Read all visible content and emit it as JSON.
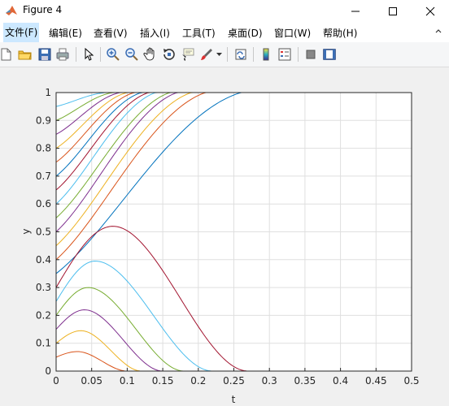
{
  "window": {
    "title": "Figure 4",
    "minimize_icon": "minimize-icon",
    "maximize_icon": "maximize-icon",
    "close_icon": "close-icon"
  },
  "menu": {
    "items": [
      {
        "label": "文件(F)"
      },
      {
        "label": "编辑(E)"
      },
      {
        "label": "查看(V)"
      },
      {
        "label": "插入(I)"
      },
      {
        "label": "工具(T)"
      },
      {
        "label": "桌面(D)"
      },
      {
        "label": "窗口(W)"
      },
      {
        "label": "帮助(H)"
      }
    ]
  },
  "toolbar": {
    "buttons": [
      "new-figure-icon",
      "open-file-icon",
      "save-icon",
      "print-icon",
      "pointer-icon",
      "zoom-in-icon",
      "zoom-out-icon",
      "pan-icon",
      "rotate-3d-icon",
      "data-cursor-icon",
      "brush-icon",
      "link-plot-icon",
      "colorbar-icon",
      "legend-icon",
      "hide-plot-tools-icon",
      "show-plot-tools-icon"
    ]
  },
  "chart_data": {
    "type": "line",
    "xlabel": "t",
    "ylabel": "y",
    "xlim": [
      0,
      0.5
    ],
    "ylim": [
      0,
      1
    ],
    "grid": true,
    "xticks": [
      "0",
      "0.05",
      "0.1",
      "0.15",
      "0.2",
      "0.25",
      "0.3",
      "0.35",
      "0.4",
      "0.45",
      "0.5"
    ],
    "yticks": [
      "0",
      "0.1",
      "0.2",
      "0.3",
      "0.4",
      "0.5",
      "0.6",
      "0.7",
      "0.8",
      "0.9",
      "1"
    ],
    "colors": [
      "#0072BD",
      "#D95319",
      "#EDB120",
      "#7E2F8E",
      "#77AC30",
      "#4DBEEE",
      "#A2142F"
    ],
    "series_rising": {
      "description_initial_values": [
        0.35,
        0.4,
        0.45,
        0.5,
        0.55,
        0.6,
        0.65,
        0.7,
        0.75,
        0.8,
        0.85,
        0.9,
        0.95
      ],
      "approx_time_to_1": [
        0.26,
        0.21,
        0.19,
        0.17,
        0.16,
        0.14,
        0.13,
        0.12,
        0.11,
        0.1,
        0.09,
        0.08,
        0.07
      ]
    },
    "series_hump": {
      "initial_values": [
        0.05,
        0.1,
        0.15,
        0.2,
        0.25,
        0.3
      ],
      "peak_t": [
        0.03,
        0.035,
        0.04,
        0.045,
        0.055,
        0.08
      ],
      "peak_y": [
        0.07,
        0.145,
        0.22,
        0.3,
        0.395,
        0.52
      ],
      "end_t": [
        0.1,
        0.12,
        0.15,
        0.18,
        0.22,
        0.27
      ]
    }
  }
}
